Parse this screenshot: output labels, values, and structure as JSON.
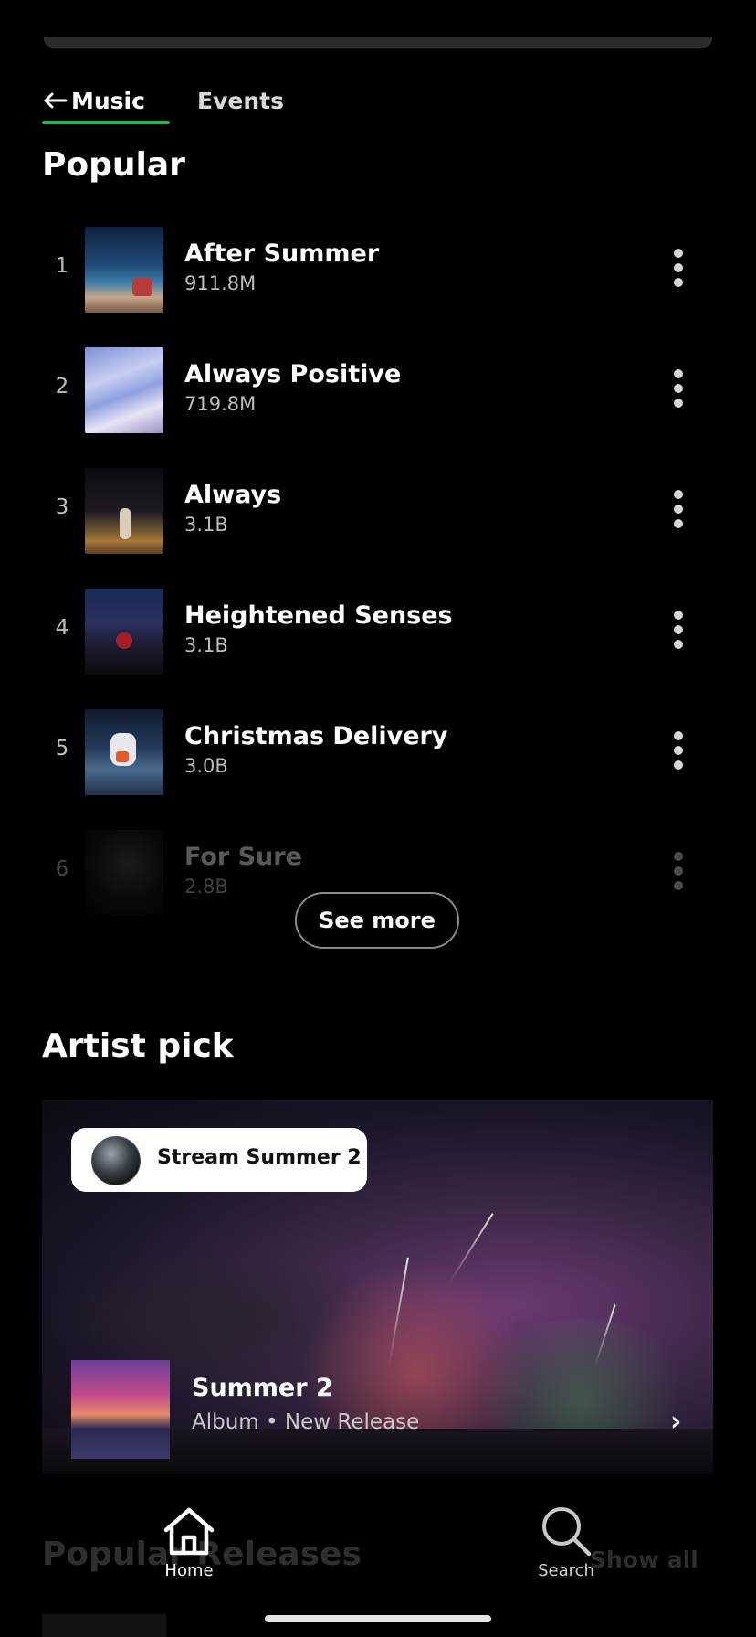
{
  "tabs": {
    "music": "Music",
    "events": "Events"
  },
  "popular": {
    "title": "Popular",
    "tracks": [
      {
        "rank": "1",
        "title": "After Summer",
        "plays": "911.8M"
      },
      {
        "rank": "2",
        "title": "Always Positive",
        "plays": "719.8M"
      },
      {
        "rank": "3",
        "title": "Always",
        "plays": "3.1B"
      },
      {
        "rank": "4",
        "title": "Heightened Senses",
        "plays": "3.1B"
      },
      {
        "rank": "5",
        "title": "Christmas Delivery",
        "plays": "3.0B"
      },
      {
        "rank": "6",
        "title": "For Sure",
        "plays": "2.8B"
      }
    ],
    "see_more": "See more"
  },
  "artist_pick": {
    "title": "Artist pick",
    "pill_label": "Stream Summer 2",
    "album_title": "Summer 2",
    "album_subtitle": "Album • New Release"
  },
  "popular_releases": {
    "title": "Popular Releases",
    "show_all": "Show all"
  },
  "bottom_nav": {
    "home": "Home",
    "search": "Search"
  },
  "colors": {
    "accent": "#1db954",
    "background": "#000000"
  }
}
